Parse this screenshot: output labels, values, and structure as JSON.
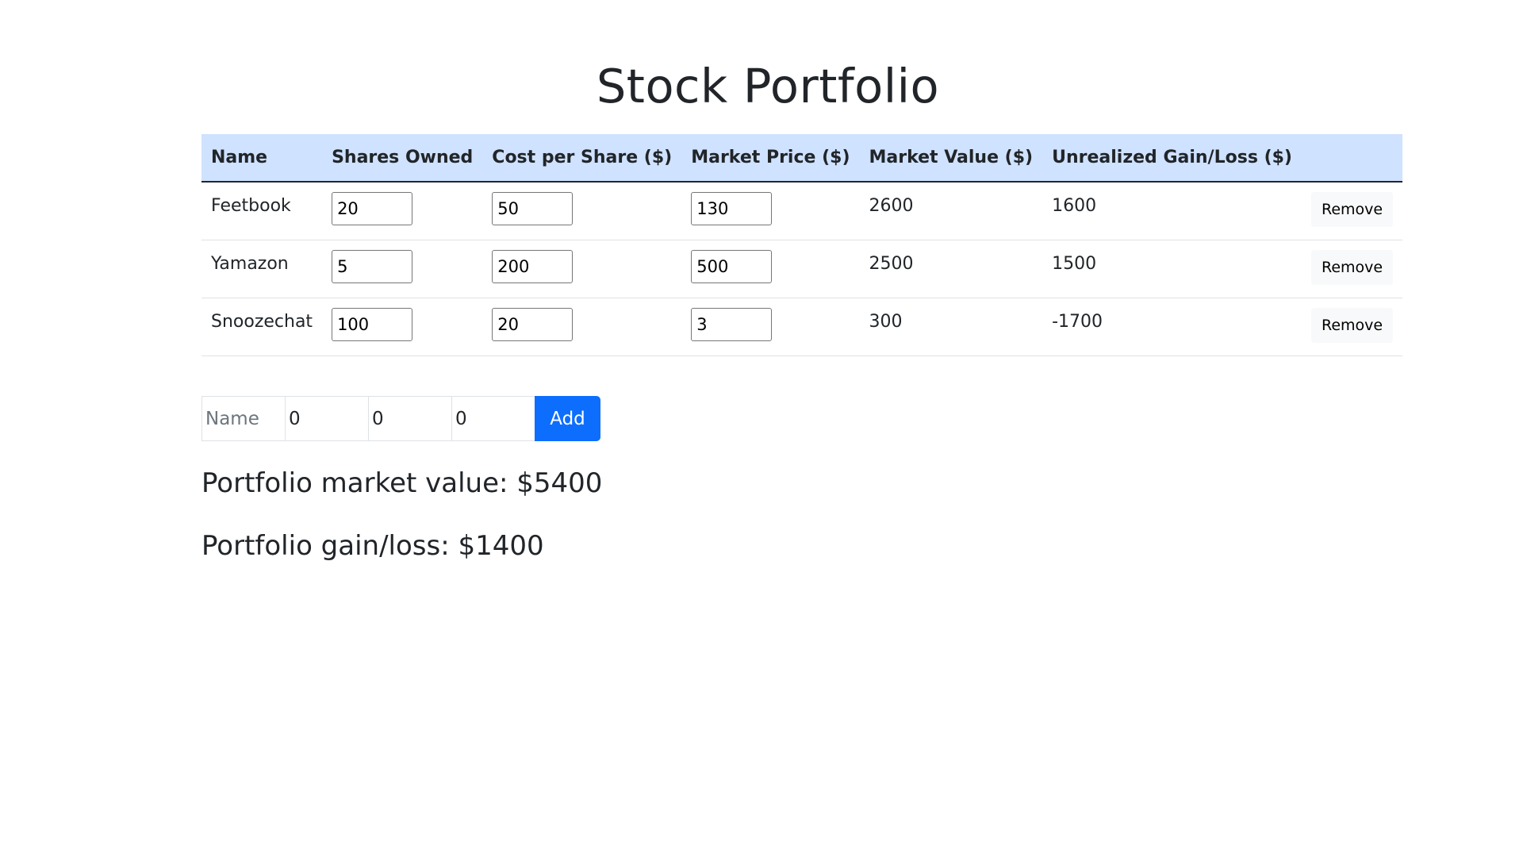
{
  "page": {
    "title": "Stock Portfolio"
  },
  "table": {
    "headers": [
      "Name",
      "Shares Owned",
      "Cost per Share ($)",
      "Market Price ($)",
      "Market Value ($)",
      "Unrealized Gain/Loss ($)"
    ],
    "remove_label": "Remove",
    "rows": [
      {
        "name": "Feetbook",
        "shares": "20",
        "cost": "50",
        "price": "130",
        "market_value": "2600",
        "gain": "1600"
      },
      {
        "name": "Yamazon",
        "shares": "5",
        "cost": "200",
        "price": "500",
        "market_value": "2500",
        "gain": "1500"
      },
      {
        "name": "Snoozechat",
        "shares": "100",
        "cost": "20",
        "price": "3",
        "market_value": "300",
        "gain": "-1700"
      }
    ]
  },
  "add_form": {
    "name_placeholder": "Name",
    "name_value": "",
    "shares_value": "0",
    "cost_value": "0",
    "price_value": "0",
    "add_label": "Add"
  },
  "summary": {
    "market_value_text": "Portfolio market value: $5400",
    "gain_text": "Portfolio gain/loss: $1400"
  },
  "colors": {
    "header_bg": "#cfe2ff",
    "primary": "#0d6efd",
    "text": "#212529"
  }
}
